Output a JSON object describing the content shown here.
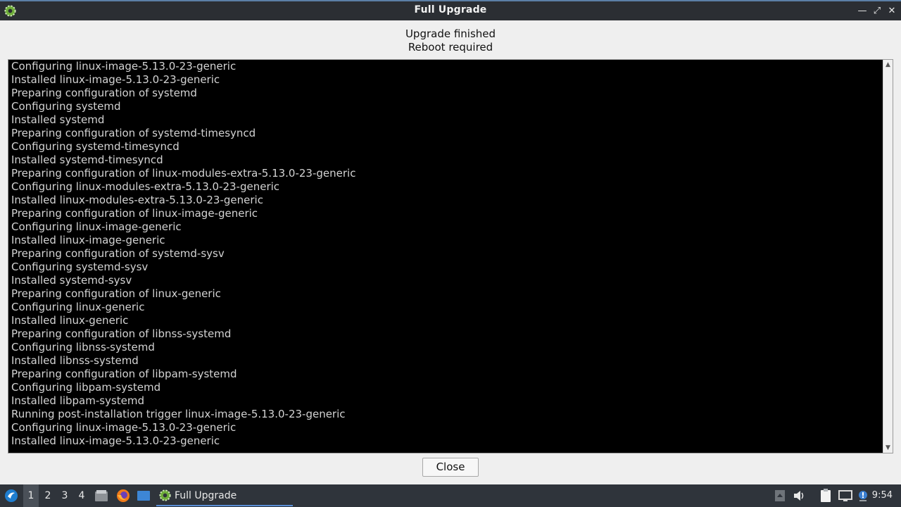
{
  "window": {
    "title": "Full Upgrade",
    "controls": [
      "minimize",
      "maximize",
      "close"
    ]
  },
  "status": {
    "line1": "Upgrade finished",
    "line2": "Reboot required"
  },
  "log": {
    "lines": [
      "Configuring linux-image-5.13.0-23-generic",
      "Installed linux-image-5.13.0-23-generic",
      "Preparing configuration of systemd",
      "Configuring systemd",
      "Installed systemd",
      "Preparing configuration of systemd-timesyncd",
      "Configuring systemd-timesyncd",
      "Installed systemd-timesyncd",
      "Preparing configuration of linux-modules-extra-5.13.0-23-generic",
      "Configuring linux-modules-extra-5.13.0-23-generic",
      "Installed linux-modules-extra-5.13.0-23-generic",
      "Preparing configuration of linux-image-generic",
      "Configuring linux-image-generic",
      "Installed linux-image-generic",
      "Preparing configuration of systemd-sysv",
      "Configuring systemd-sysv",
      "Installed systemd-sysv",
      "Preparing configuration of linux-generic",
      "Configuring linux-generic",
      "Installed linux-generic",
      "Preparing configuration of libnss-systemd",
      "Configuring libnss-systemd",
      "Installed libnss-systemd",
      "Preparing configuration of libpam-systemd",
      "Configuring libpam-systemd",
      "Installed libpam-systemd",
      "Running post-installation trigger linux-image-5.13.0-23-generic",
      "Configuring linux-image-5.13.0-23-generic",
      "Installed linux-image-5.13.0-23-generic"
    ]
  },
  "buttons": {
    "close_label": "Close"
  },
  "taskbar": {
    "workspaces": [
      "1",
      "2",
      "3",
      "4"
    ],
    "active_workspace": "1",
    "task_label": "Full Upgrade",
    "clock": "9:54",
    "launchers": [
      "start-menu-icon",
      "file-manager-icon",
      "firefox-icon",
      "show-desktop-icon"
    ],
    "tray": [
      "screenshot-icon",
      "volume-icon",
      "clipboard-icon",
      "network-icon",
      "update-notifier-icon"
    ]
  },
  "colors": {
    "titlebar_bg": "#2b2e33",
    "log_bg": "#000000",
    "log_text": "#d3d3d3",
    "taskbar_bg": "#2f343b",
    "accent": "#5b8fd6"
  }
}
